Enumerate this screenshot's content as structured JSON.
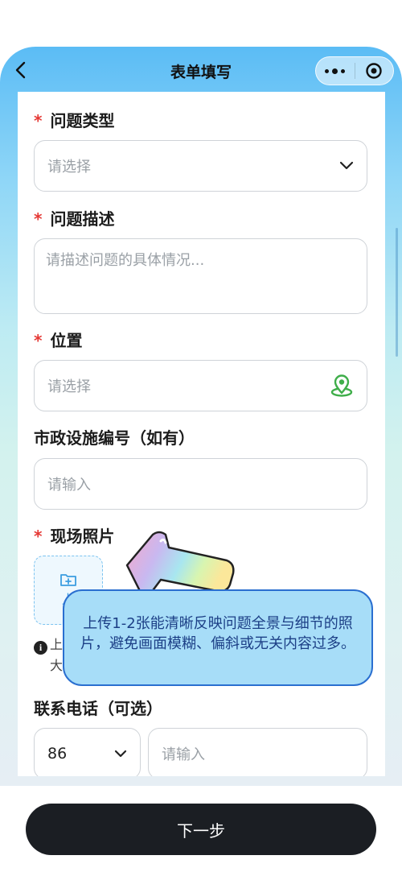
{
  "nav": {
    "title": "表单填写"
  },
  "form": {
    "issue_type": {
      "label": "问题类型",
      "required_mark": "*",
      "placeholder": "请选择"
    },
    "issue_desc": {
      "label": "问题描述",
      "required_mark": "*",
      "placeholder": "请描述问题的具体情况..."
    },
    "location": {
      "label": "位置",
      "required_mark": "*",
      "placeholder": "请选择"
    },
    "facility_no": {
      "label": "市政设施编号（如有）",
      "placeholder": "请输入"
    },
    "photos": {
      "label": "现场照片",
      "required_mark": "*",
      "upload_label": "上",
      "hint_line1": "上",
      "hint_line2": "大"
    },
    "phone": {
      "label": "联系电话（可选）",
      "country_code": "86",
      "placeholder": "请输入"
    }
  },
  "tooltip": {
    "text": "上传1-2张能清晰反映问题全景与细节的照片，避免画面模糊、偏斜或无关内容过多。"
  },
  "footer": {
    "next_label": "下一步"
  },
  "colors": {
    "accent": "#3b9de0",
    "required": "#e53935",
    "location_icon": "#3fae4a",
    "button": "#1b1e23",
    "tooltip_bg": "#a7ddf8",
    "tooltip_border": "#2a6fd0"
  }
}
